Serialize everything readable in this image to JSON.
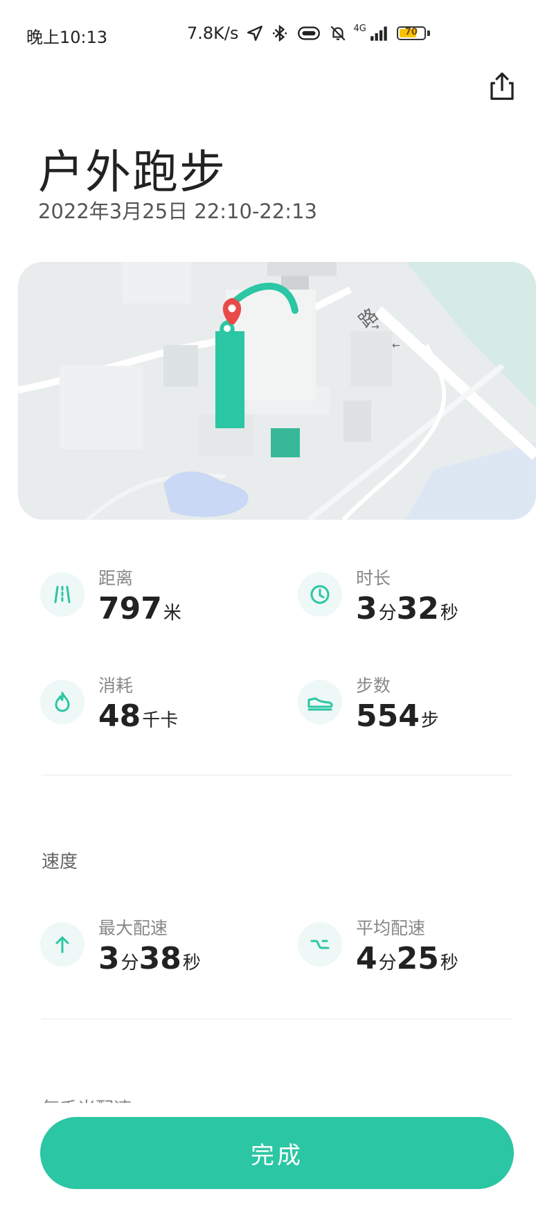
{
  "status_bar": {
    "time": "晚上10:13",
    "net_speed": "7.8K/s",
    "network_type": "4G",
    "battery_level": "70",
    "battery_percent": 0.7,
    "icons": [
      "location-arrow-icon",
      "bluetooth-icon",
      "vibrate-icon",
      "mute-bell-icon",
      "signal-icon",
      "battery-icon"
    ]
  },
  "header": {
    "title": "户外跑步",
    "subtitle": "2022年3月25日 22:10-22:13",
    "share_icon": "share-icon"
  },
  "map": {
    "road_label": "路",
    "route_color": "#2bc6a3",
    "end_marker_color": "#e84a4a"
  },
  "stats": [
    {
      "label": "距离",
      "value": "797",
      "unit": "米",
      "icon": "distance-icon"
    },
    {
      "label": "时长",
      "value_parts": [
        {
          "n": "3",
          "u": "分"
        },
        {
          "n": "32",
          "u": "秒"
        }
      ],
      "icon": "clock-icon"
    },
    {
      "label": "消耗",
      "value": "48",
      "unit": "千卡",
      "icon": "flame-icon"
    },
    {
      "label": "步数",
      "value": "554",
      "unit": "步",
      "icon": "shoe-icon"
    }
  ],
  "speed": {
    "section_title": "速度",
    "max_pace": {
      "label": "最大配速",
      "min": "3",
      "min_unit": "分",
      "sec": "38",
      "sec_unit": "秒",
      "icon": "arrow-up-icon"
    },
    "avg_pace": {
      "label": "平均配速",
      "min": "4",
      "min_unit": "分",
      "sec": "25",
      "sec_unit": "秒",
      "icon": "wave-icon"
    }
  },
  "next_section_label": "每千米配速",
  "done_button": {
    "label": "完成"
  },
  "colors": {
    "accent": "#2bc6a3",
    "icon_bg": "#eef8f6"
  }
}
